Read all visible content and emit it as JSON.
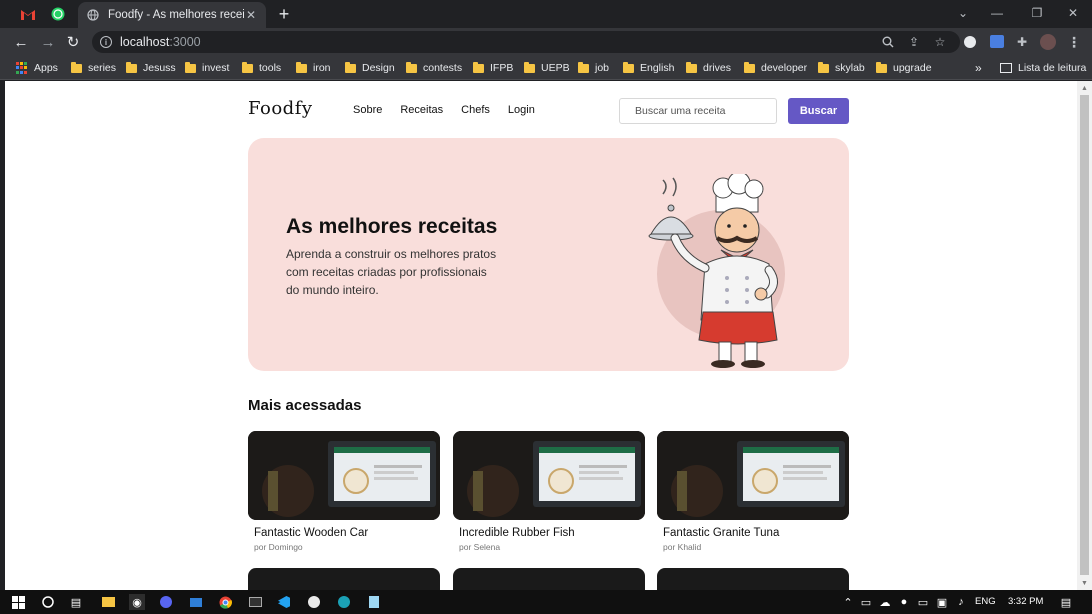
{
  "browser": {
    "tab": {
      "title": "Foodfy - As melhores receitas"
    },
    "omnibox": {
      "host": "localhost",
      "port": ":3000"
    },
    "bookmarks": [
      "Apps",
      "series",
      "Jesuss",
      "invest",
      "tools",
      "iron",
      "Design",
      "contests",
      "IFPB",
      "UEPB",
      "job",
      "English",
      "drives",
      "developer",
      "skylab",
      "upgrade"
    ],
    "reading_list": "Lista de leitura"
  },
  "site": {
    "logo": "Foodfy",
    "nav": [
      "Sobre",
      "Receitas",
      "Chefs",
      "Login"
    ],
    "search": {
      "placeholder": "Buscar uma receita",
      "button": "Buscar"
    },
    "hero": {
      "title": "As melhores receitas",
      "description": "Aprenda a construir os melhores pratos com receitas criadas por profissionais do mundo inteiro."
    },
    "section_title": "Mais acessadas",
    "recipes": [
      {
        "name": "Fantastic Wooden Car",
        "author": "por Domingo"
      },
      {
        "name": "Incredible Rubber Fish",
        "author": "por Selena"
      },
      {
        "name": "Fantastic Granite Tuna",
        "author": "por Khalid"
      }
    ]
  },
  "taskbar": {
    "language": "ENG",
    "time": "3:32 PM"
  },
  "colors": {
    "accent": "#6558c5",
    "hero_bg": "#f9dedb",
    "chrome_dark": "#202124",
    "chrome_toolbar": "#35363a"
  }
}
